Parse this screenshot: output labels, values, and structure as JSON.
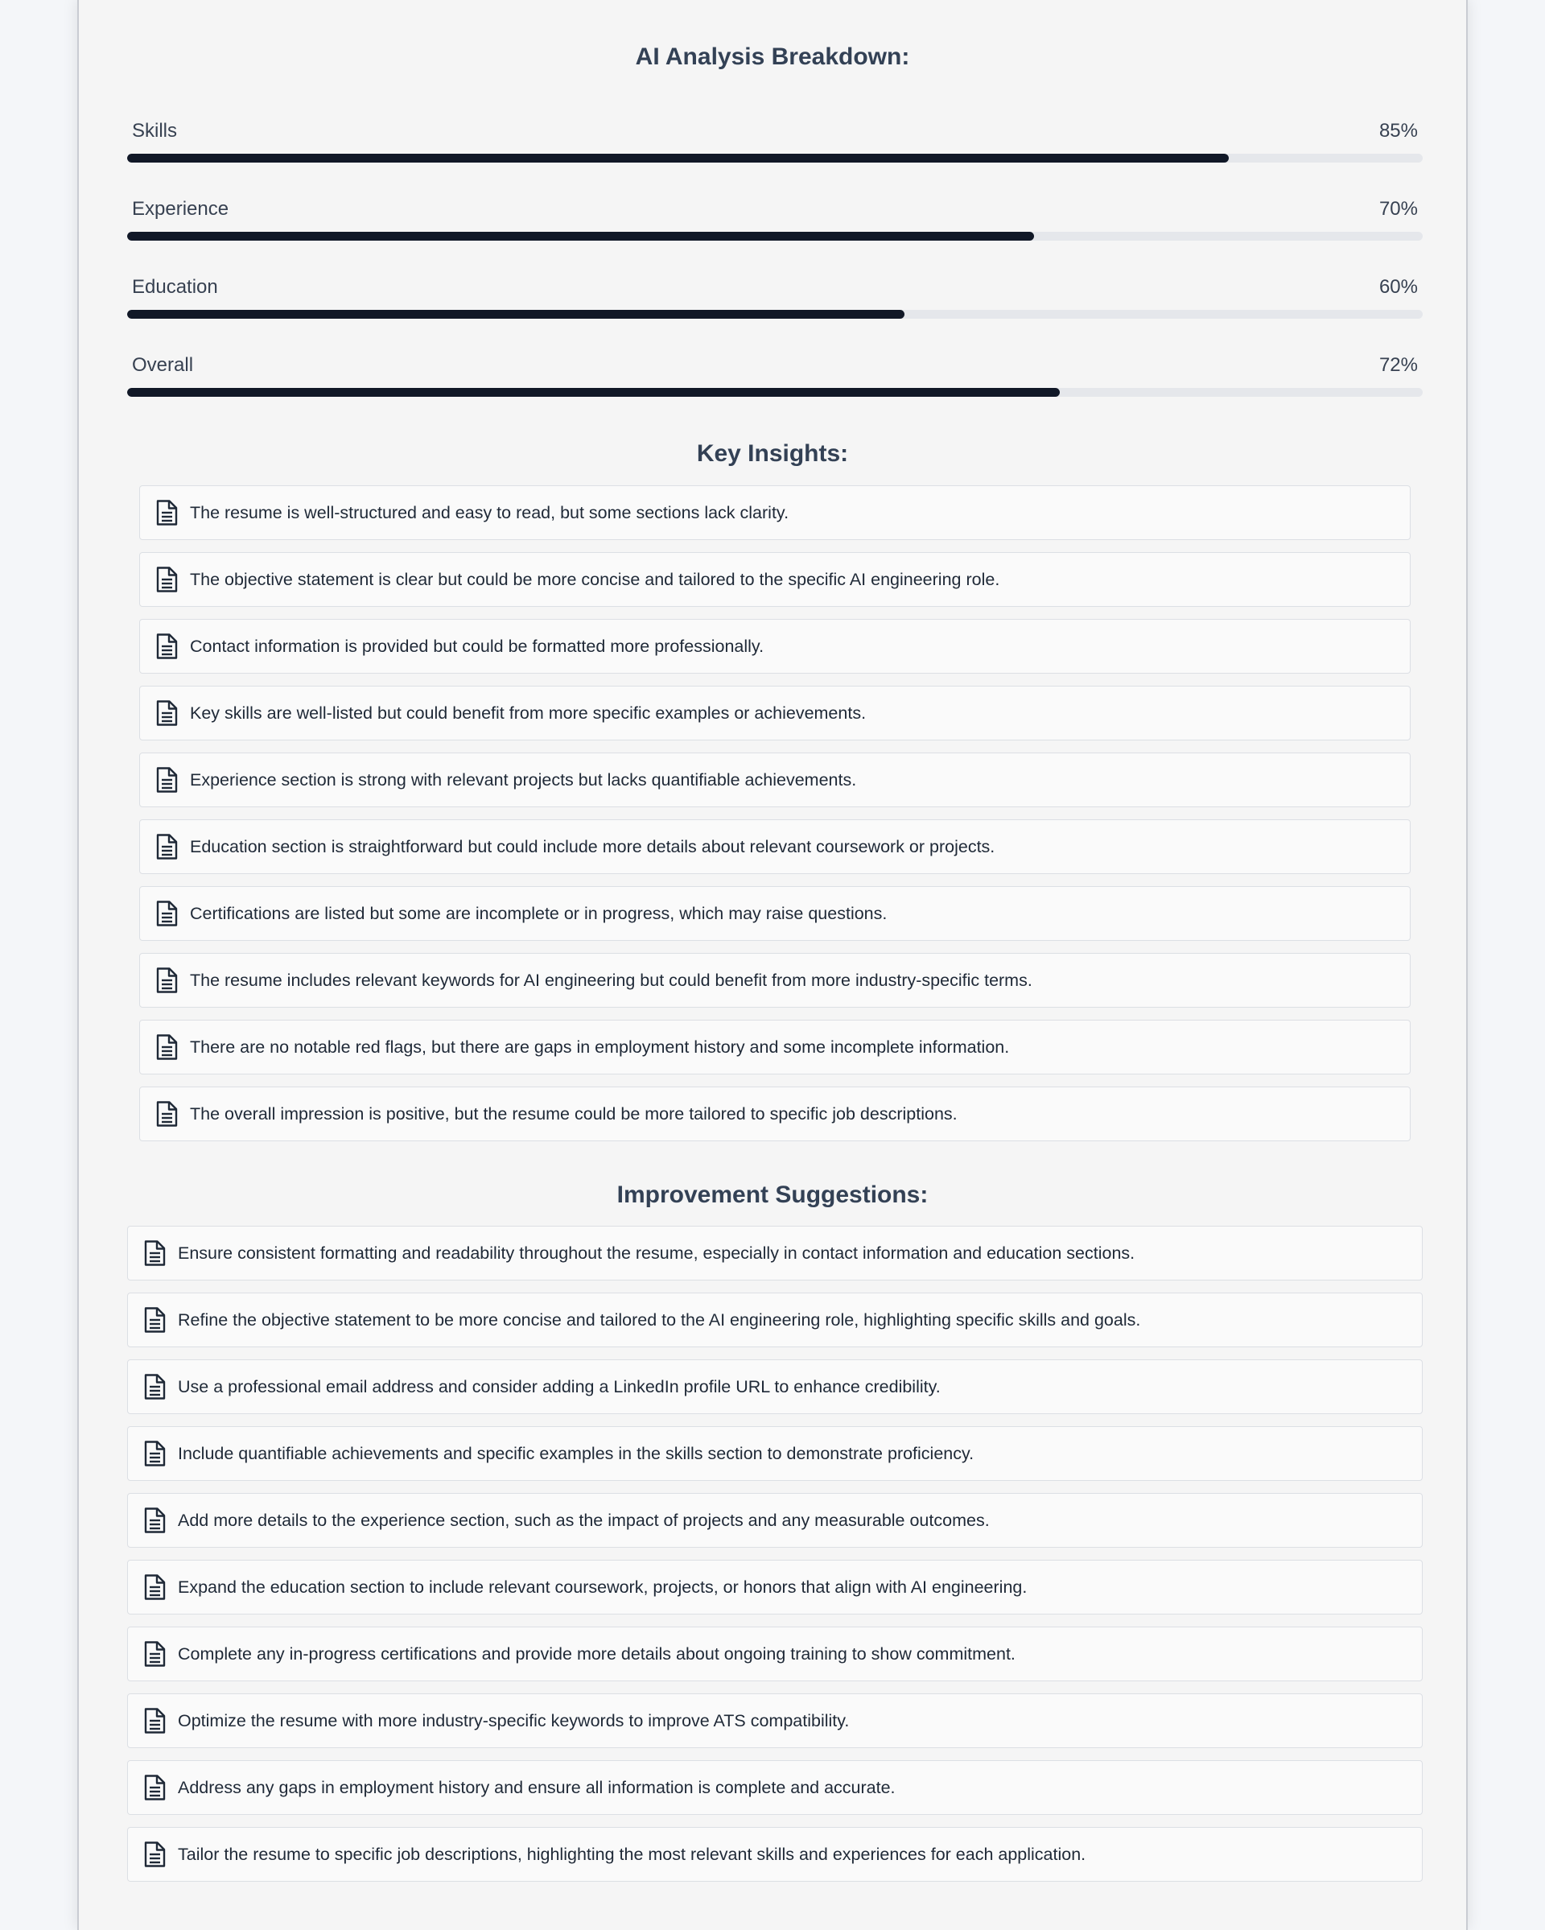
{
  "breakdown": {
    "title": "AI Analysis Breakdown:",
    "metrics": [
      {
        "label": "Skills",
        "value_text": "85%",
        "percent": 85
      },
      {
        "label": "Experience",
        "value_text": "70%",
        "percent": 70
      },
      {
        "label": "Education",
        "value_text": "60%",
        "percent": 60
      },
      {
        "label": "Overall",
        "value_text": "72%",
        "percent": 72
      }
    ]
  },
  "insights": {
    "title": "Key Insights:",
    "icon": "document-icon",
    "items": [
      "The resume is well-structured and easy to read, but some sections lack clarity.",
      "The objective statement is clear but could be more concise and tailored to the specific AI engineering role.",
      "Contact information is provided but could be formatted more professionally.",
      "Key skills are well-listed but could benefit from more specific examples or achievements.",
      "Experience section is strong with relevant projects but lacks quantifiable achievements.",
      "Education section is straightforward but could include more details about relevant coursework or projects.",
      "Certifications are listed but some are incomplete or in progress, which may raise questions.",
      "The resume includes relevant keywords for AI engineering but could benefit from more industry-specific terms.",
      "There are no notable red flags, but there are gaps in employment history and some incomplete information.",
      "The overall impression is positive, but the resume could be more tailored to specific job descriptions."
    ]
  },
  "suggestions": {
    "title": "Improvement Suggestions:",
    "icon": "document-icon",
    "items": [
      "Ensure consistent formatting and readability throughout the resume, especially in contact information and education sections.",
      "Refine the objective statement to be more concise and tailored to the AI engineering role, highlighting specific skills and goals.",
      "Use a professional email address and consider adding a LinkedIn profile URL to enhance credibility.",
      "Include quantifiable achievements and specific examples in the skills section to demonstrate proficiency.",
      "Add more details to the experience section, such as the impact of projects and any measurable outcomes.",
      "Expand the education section to include relevant coursework, projects, or honors that align with AI engineering.",
      "Complete any in-progress certifications and provide more details about ongoing training to show commitment.",
      "Optimize the resume with more industry-specific keywords to improve ATS compatibility.",
      "Address any gaps in employment history and ensure all information is complete and accurate.",
      "Tailor the resume to specific job descriptions, highlighting the most relevant skills and experiences for each application."
    ]
  },
  "colors": {
    "bar_fill": "#111827",
    "bar_track": "#e5e7eb",
    "heading": "#334155"
  }
}
